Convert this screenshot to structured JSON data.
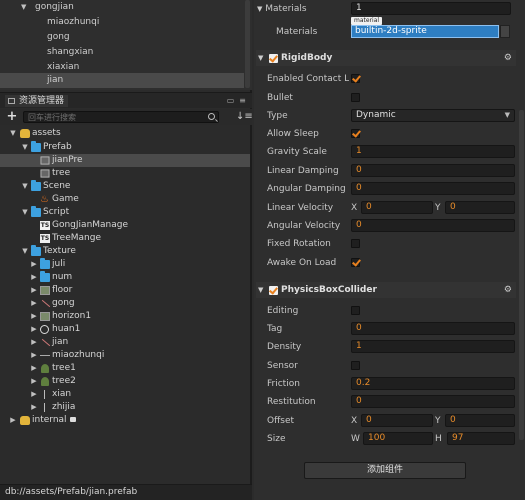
{
  "node_tree": {
    "items": [
      {
        "label": "gongjian",
        "indent": 1
      },
      {
        "label": "miaozhunqi",
        "indent": 2
      },
      {
        "label": "gong",
        "indent": 2
      },
      {
        "label": "shangxian",
        "indent": 2
      },
      {
        "label": "xiaxian",
        "indent": 2
      },
      {
        "label": "jian",
        "indent": 2,
        "selected": true
      }
    ]
  },
  "assets_panel": {
    "title": "资源管理器",
    "search_placeholder": "回车进行搜索",
    "tree": [
      {
        "label": "assets",
        "depth": 0,
        "arrow": "down",
        "icon": "db"
      },
      {
        "label": "Prefab",
        "depth": 1,
        "arrow": "down",
        "icon": "folder"
      },
      {
        "label": "jianPre",
        "depth": 2,
        "icon": "cube",
        "selected": true
      },
      {
        "label": "tree",
        "depth": 2,
        "icon": "cube"
      },
      {
        "label": "Scene",
        "depth": 1,
        "arrow": "down",
        "icon": "folder"
      },
      {
        "label": "Game",
        "depth": 2,
        "icon": "fire"
      },
      {
        "label": "Script",
        "depth": 1,
        "arrow": "down",
        "icon": "folder"
      },
      {
        "label": "GongJianManage",
        "depth": 2,
        "icon": "script"
      },
      {
        "label": "TreeMange",
        "depth": 2,
        "icon": "script"
      },
      {
        "label": "Texture",
        "depth": 1,
        "arrow": "down",
        "icon": "folder"
      },
      {
        "label": "juli",
        "depth": 2,
        "arrow": "right",
        "icon": "folder"
      },
      {
        "label": "num",
        "depth": 2,
        "arrow": "right",
        "icon": "folder"
      },
      {
        "label": "floor",
        "depth": 2,
        "arrow": "right",
        "icon": "tex"
      },
      {
        "label": "gong",
        "depth": 2,
        "arrow": "right",
        "icon": "sword"
      },
      {
        "label": "horizon1",
        "depth": 2,
        "arrow": "right",
        "icon": "tex"
      },
      {
        "label": "huan1",
        "depth": 2,
        "arrow": "right",
        "icon": "circle"
      },
      {
        "label": "jian",
        "depth": 2,
        "arrow": "right",
        "icon": "sword"
      },
      {
        "label": "miaozhunqi",
        "depth": 2,
        "arrow": "right",
        "icon": "line"
      },
      {
        "label": "tree1",
        "depth": 2,
        "arrow": "right",
        "icon": "tree"
      },
      {
        "label": "tree2",
        "depth": 2,
        "arrow": "right",
        "icon": "tree"
      },
      {
        "label": "xian",
        "depth": 2,
        "arrow": "right",
        "icon": "thin"
      },
      {
        "label": "zhijia",
        "depth": 2,
        "arrow": "right",
        "icon": "thin"
      },
      {
        "label": "internal",
        "depth": 0,
        "arrow": "right",
        "icon": "db",
        "lock": true
      }
    ]
  },
  "status_bar": {
    "path": "db://assets/Prefab/jian.prefab"
  },
  "inspector": {
    "materials": {
      "count_label": "Materials",
      "count_value": "1",
      "item_label": "Materials",
      "tag": "material",
      "value": "builtin-2d-sprite"
    },
    "rigidbody": {
      "title": "RigidBody",
      "enabled_contact_listener": {
        "label": "Enabled Contact Li...",
        "checked": true
      },
      "bullet": {
        "label": "Bullet",
        "checked": false
      },
      "type": {
        "label": "Type",
        "value": "Dynamic"
      },
      "allow_sleep": {
        "label": "Allow Sleep",
        "checked": true
      },
      "gravity_scale": {
        "label": "Gravity Scale",
        "value": "1"
      },
      "linear_damping": {
        "label": "Linear Damping",
        "value": "0"
      },
      "angular_damping": {
        "label": "Angular Damping",
        "value": "0"
      },
      "linear_velocity": {
        "label": "Linear Velocity",
        "x_label": "X",
        "x": "0",
        "y_label": "Y",
        "y": "0"
      },
      "angular_velocity": {
        "label": "Angular Velocity",
        "value": "0"
      },
      "fixed_rotation": {
        "label": "Fixed Rotation",
        "checked": false
      },
      "awake_on_load": {
        "label": "Awake On Load",
        "checked": true
      }
    },
    "box_collider": {
      "title": "PhysicsBoxCollider",
      "editing": {
        "label": "Editing",
        "checked": false
      },
      "tag": {
        "label": "Tag",
        "value": "0"
      },
      "density": {
        "label": "Density",
        "value": "1"
      },
      "sensor": {
        "label": "Sensor",
        "checked": false
      },
      "friction": {
        "label": "Friction",
        "value": "0.2"
      },
      "restitution": {
        "label": "Restitution",
        "value": "0"
      },
      "offset": {
        "label": "Offset",
        "x_label": "X",
        "x": "0",
        "y_label": "Y",
        "y": "0"
      },
      "size": {
        "label": "Size",
        "w_label": "W",
        "w": "100",
        "h_label": "H",
        "h": "97"
      }
    },
    "add_component_label": "添加组件"
  },
  "colors": {
    "accent": "#e8801e",
    "selection": "#2e7ec2",
    "folder": "#3da1e0"
  }
}
